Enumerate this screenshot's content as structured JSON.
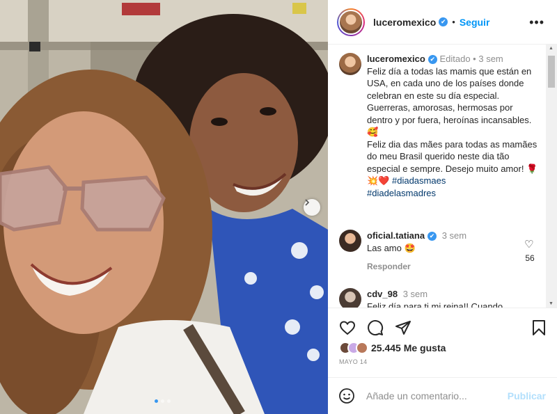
{
  "post": {
    "username": "luceromexico",
    "follow_label": "Seguir",
    "separator": "•",
    "more_label": "•••",
    "verified_mark": "✔",
    "caption": {
      "author": "luceromexico",
      "edited": "Editado",
      "time": "3 sem",
      "text_1": "Feliz día a todas las mamis que están en USA, en cada uno de los países donde celebran en este su día especial. Guerreras, amorosas, hermosas por dentro y por fuera, heroínas incansables. 🥰",
      "text_2": "Feliz dia das mães para todas as mamães do meu Brasil querido neste dia tão especial e sempre. Desejo muito amor! 🌹💥❤️",
      "hashtag_1": "#diadasmaes",
      "hashtag_2": "#diadelasmadres"
    },
    "comments": [
      {
        "author": "oficial.tatiana",
        "time": "3 sem",
        "text": "Las amo 🤩",
        "reply_label": "Responder",
        "likes": "56",
        "verified": true
      },
      {
        "author": "cdv_98",
        "time": "3 sem",
        "text": "Feliz día para ti mi reina!! Cuando"
      }
    ],
    "likes_text": "25.445 Me gusta",
    "date": "MAYO 14",
    "comment_placeholder": "Añade un comentario...",
    "publish_label": "Publicar",
    "photo": {
      "carousel_count": 3,
      "carousel_active": 0
    },
    "colors": {
      "link_blue": "#0095f6",
      "verified_blue": "#3897f0",
      "muted": "#8e8e8e",
      "publish_disabled": "#b2dffc"
    }
  }
}
